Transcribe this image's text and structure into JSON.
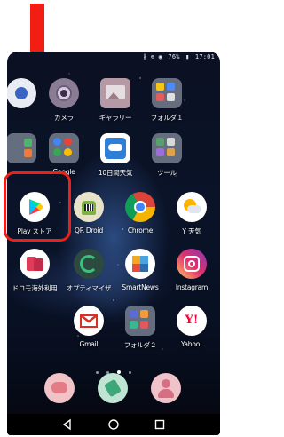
{
  "status_bar": {
    "icons_text": "∦ ⊕ ◉",
    "battery": "76%",
    "time": "17:01"
  },
  "row1": [
    {
      "label": "",
      "icon": "partial-icon"
    },
    {
      "label": "カメラ",
      "icon": "camera-icon"
    },
    {
      "label": "ギャラリー",
      "icon": "gallery-icon"
    },
    {
      "label": "フォルダ１",
      "icon": "folder-icon"
    }
  ],
  "row2": [
    {
      "label": "",
      "icon": "partial-icon"
    },
    {
      "label": "Google",
      "icon": "google-folder-icon"
    },
    {
      "label": "10日間天気",
      "icon": "weather-app-icon"
    },
    {
      "label": "ツール",
      "icon": "tools-folder-icon"
    }
  ],
  "row3": [
    {
      "label": "Play ストア",
      "icon": "play-store-icon"
    },
    {
      "label": "QR Droid",
      "icon": "qr-droid-icon"
    },
    {
      "label": "Chrome",
      "icon": "chrome-icon"
    },
    {
      "label": "Y 天気",
      "icon": "yahoo-weather-icon"
    }
  ],
  "row4": [
    {
      "label": "ドコモ海外利用",
      "icon": "docomo-overseas-icon"
    },
    {
      "label": "オプティマイザ",
      "icon": "optimizer-icon"
    },
    {
      "label": "SmartNews",
      "icon": "smartnews-icon"
    },
    {
      "label": "Instagram",
      "icon": "instagram-icon"
    }
  ],
  "row5": [
    {
      "label": "Gmail",
      "icon": "gmail-icon"
    },
    {
      "label": "フォルダ２",
      "icon": "folder-icon"
    },
    {
      "label": "Yahoo!",
      "icon": "yahoo-icon"
    }
  ],
  "yahoo_logo_text": "Y!",
  "dock": [
    "messages-icon",
    "phone-icon",
    "contacts-icon"
  ],
  "nav": [
    "back-icon",
    "home-icon",
    "recents-icon"
  ],
  "colors": {
    "highlight": "#e8211a",
    "arrow": "#f21d13"
  }
}
